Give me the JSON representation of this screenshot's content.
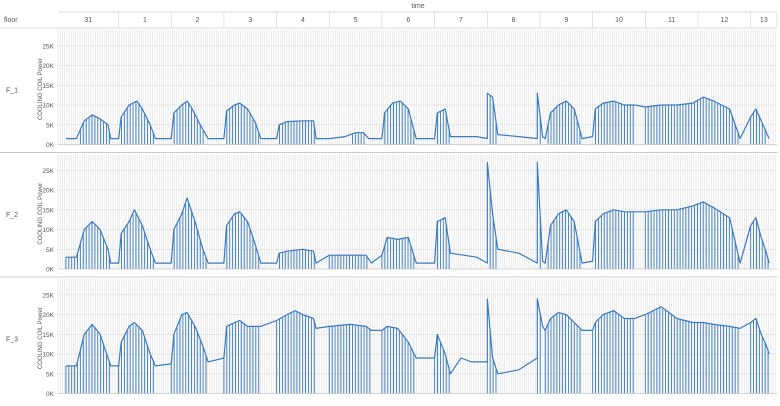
{
  "chart_data": {
    "type": "line",
    "top_axis_title": "time",
    "row_header_label": "floor",
    "ylabel": "COOLING COIL Power",
    "ylim": [
      0,
      28000
    ],
    "y_ticks": [
      0,
      5000,
      10000,
      15000,
      20000,
      25000
    ],
    "y_tick_labels": [
      "0K",
      "5K",
      "10K",
      "15K",
      "20K",
      "25K"
    ],
    "x_range_days": [
      31,
      13
    ],
    "x_tick_labels": [
      "31",
      "1",
      "2",
      "3",
      "4",
      "5",
      "6",
      "7",
      "8",
      "9",
      "10",
      "11",
      "12",
      "13"
    ],
    "series_color": "#3a7bbf",
    "grid": true,
    "series": [
      {
        "name": "F_1",
        "points": [
          [
            0.0,
            1500
          ],
          [
            0.2,
            1500
          ],
          [
            0.35,
            6000
          ],
          [
            0.5,
            7500
          ],
          [
            0.65,
            6500
          ],
          [
            0.8,
            5000
          ],
          [
            0.85,
            1500
          ],
          [
            1.0,
            1500
          ],
          [
            1.05,
            7000
          ],
          [
            1.2,
            10000
          ],
          [
            1.35,
            11000
          ],
          [
            1.45,
            9000
          ],
          [
            1.6,
            5000
          ],
          [
            1.7,
            1500
          ],
          [
            2.0,
            1500
          ],
          [
            2.05,
            8000
          ],
          [
            2.2,
            10000
          ],
          [
            2.3,
            11000
          ],
          [
            2.4,
            9000
          ],
          [
            2.55,
            5000
          ],
          [
            2.7,
            1500
          ],
          [
            3.0,
            1500
          ],
          [
            3.05,
            8500
          ],
          [
            3.2,
            10000
          ],
          [
            3.3,
            10500
          ],
          [
            3.45,
            9000
          ],
          [
            3.6,
            5500
          ],
          [
            3.7,
            1500
          ],
          [
            4.0,
            1500
          ],
          [
            4.05,
            5000
          ],
          [
            4.2,
            5800
          ],
          [
            4.5,
            6000
          ],
          [
            4.7,
            6000
          ],
          [
            4.75,
            1500
          ],
          [
            5.0,
            1500
          ],
          [
            5.3,
            2000
          ],
          [
            5.5,
            3000
          ],
          [
            5.65,
            3000
          ],
          [
            5.75,
            1500
          ],
          [
            6.0,
            1500
          ],
          [
            6.05,
            8000
          ],
          [
            6.2,
            10500
          ],
          [
            6.35,
            11000
          ],
          [
            6.5,
            9000
          ],
          [
            6.65,
            1500
          ],
          [
            7.0,
            1500
          ],
          [
            7.05,
            8000
          ],
          [
            7.2,
            9000
          ],
          [
            7.3,
            2000
          ],
          [
            7.8,
            2000
          ],
          [
            8.0,
            1500
          ],
          [
            8.0,
            13000
          ],
          [
            8.1,
            12000
          ],
          [
            8.2,
            2500
          ],
          [
            8.6,
            2000
          ],
          [
            8.95,
            1500
          ],
          [
            8.95,
            13000
          ],
          [
            9.05,
            2000
          ],
          [
            9.1,
            1500
          ],
          [
            9.2,
            8000
          ],
          [
            9.35,
            10000
          ],
          [
            9.5,
            11000
          ],
          [
            9.65,
            9000
          ],
          [
            9.8,
            1500
          ],
          [
            10.0,
            2000
          ],
          [
            10.05,
            9000
          ],
          [
            10.2,
            10500
          ],
          [
            10.4,
            11000
          ],
          [
            10.6,
            10000
          ],
          [
            10.8,
            10000
          ],
          [
            11.0,
            9500
          ],
          [
            11.3,
            10000
          ],
          [
            11.6,
            10000
          ],
          [
            11.9,
            10500
          ],
          [
            12.1,
            12000
          ],
          [
            12.3,
            11000
          ],
          [
            12.6,
            9000
          ],
          [
            12.8,
            1500
          ],
          [
            13.0,
            7000
          ],
          [
            13.1,
            9000
          ],
          [
            13.2,
            6000
          ],
          [
            13.3,
            3000
          ],
          [
            13.35,
            1500
          ]
        ]
      },
      {
        "name": "F_2",
        "points": [
          [
            0.0,
            3000
          ],
          [
            0.2,
            3000
          ],
          [
            0.35,
            10000
          ],
          [
            0.5,
            12000
          ],
          [
            0.65,
            10000
          ],
          [
            0.8,
            5000
          ],
          [
            0.85,
            1500
          ],
          [
            1.0,
            1500
          ],
          [
            1.05,
            9000
          ],
          [
            1.2,
            12000
          ],
          [
            1.3,
            15000
          ],
          [
            1.45,
            11000
          ],
          [
            1.6,
            5000
          ],
          [
            1.7,
            1500
          ],
          [
            2.0,
            1500
          ],
          [
            2.05,
            10000
          ],
          [
            2.2,
            14000
          ],
          [
            2.3,
            18000
          ],
          [
            2.45,
            12000
          ],
          [
            2.6,
            5000
          ],
          [
            2.7,
            1500
          ],
          [
            3.0,
            1500
          ],
          [
            3.05,
            11000
          ],
          [
            3.2,
            14000
          ],
          [
            3.3,
            14500
          ],
          [
            3.45,
            12000
          ],
          [
            3.6,
            6000
          ],
          [
            3.7,
            1500
          ],
          [
            4.0,
            1500
          ],
          [
            4.05,
            4000
          ],
          [
            4.2,
            4500
          ],
          [
            4.5,
            5000
          ],
          [
            4.7,
            4500
          ],
          [
            4.75,
            1500
          ],
          [
            5.0,
            3500
          ],
          [
            5.4,
            3500
          ],
          [
            5.7,
            3500
          ],
          [
            5.8,
            1500
          ],
          [
            6.0,
            3500
          ],
          [
            6.1,
            8000
          ],
          [
            6.3,
            7500
          ],
          [
            6.5,
            8000
          ],
          [
            6.65,
            1500
          ],
          [
            7.0,
            1500
          ],
          [
            7.05,
            12000
          ],
          [
            7.2,
            13000
          ],
          [
            7.3,
            4000
          ],
          [
            7.8,
            3000
          ],
          [
            8.0,
            1500
          ],
          [
            8.0,
            27000
          ],
          [
            8.1,
            14000
          ],
          [
            8.2,
            5000
          ],
          [
            8.6,
            4000
          ],
          [
            8.95,
            1500
          ],
          [
            8.95,
            27000
          ],
          [
            9.05,
            2000
          ],
          [
            9.1,
            1500
          ],
          [
            9.2,
            11000
          ],
          [
            9.35,
            14000
          ],
          [
            9.5,
            15000
          ],
          [
            9.65,
            12000
          ],
          [
            9.8,
            1500
          ],
          [
            10.0,
            2000
          ],
          [
            10.05,
            12000
          ],
          [
            10.2,
            14000
          ],
          [
            10.4,
            15000
          ],
          [
            10.6,
            14500
          ],
          [
            10.8,
            14500
          ],
          [
            11.0,
            14500
          ],
          [
            11.3,
            15000
          ],
          [
            11.6,
            15000
          ],
          [
            11.9,
            16000
          ],
          [
            12.1,
            17000
          ],
          [
            12.3,
            15500
          ],
          [
            12.6,
            13000
          ],
          [
            12.8,
            1500
          ],
          [
            13.0,
            11000
          ],
          [
            13.1,
            13000
          ],
          [
            13.2,
            8000
          ],
          [
            13.3,
            4000
          ],
          [
            13.35,
            1500
          ]
        ]
      },
      {
        "name": "F_3",
        "points": [
          [
            0.0,
            7000
          ],
          [
            0.2,
            7000
          ],
          [
            0.35,
            15000
          ],
          [
            0.5,
            17500
          ],
          [
            0.65,
            15000
          ],
          [
            0.8,
            9000
          ],
          [
            0.85,
            7000
          ],
          [
            1.0,
            7000
          ],
          [
            1.05,
            13000
          ],
          [
            1.2,
            17000
          ],
          [
            1.3,
            18000
          ],
          [
            1.45,
            16000
          ],
          [
            1.6,
            10000
          ],
          [
            1.7,
            7000
          ],
          [
            2.0,
            7500
          ],
          [
            2.05,
            15000
          ],
          [
            2.2,
            20000
          ],
          [
            2.3,
            20500
          ],
          [
            2.45,
            17000
          ],
          [
            2.6,
            12000
          ],
          [
            2.7,
            8000
          ],
          [
            3.0,
            9000
          ],
          [
            3.05,
            17000
          ],
          [
            3.2,
            18000
          ],
          [
            3.3,
            18500
          ],
          [
            3.45,
            17000
          ],
          [
            3.6,
            17000
          ],
          [
            3.7,
            17000
          ],
          [
            4.0,
            18500
          ],
          [
            4.2,
            20000
          ],
          [
            4.35,
            21000
          ],
          [
            4.5,
            20000
          ],
          [
            4.7,
            19000
          ],
          [
            4.75,
            16500
          ],
          [
            5.0,
            17000
          ],
          [
            5.4,
            17500
          ],
          [
            5.7,
            17000
          ],
          [
            5.8,
            16000
          ],
          [
            6.0,
            16000
          ],
          [
            6.1,
            17000
          ],
          [
            6.3,
            16500
          ],
          [
            6.5,
            13000
          ],
          [
            6.65,
            9000
          ],
          [
            7.0,
            9000
          ],
          [
            7.05,
            15000
          ],
          [
            7.2,
            10000
          ],
          [
            7.3,
            5000
          ],
          [
            7.5,
            9000
          ],
          [
            7.7,
            8000
          ],
          [
            8.0,
            8000
          ],
          [
            8.0,
            24000
          ],
          [
            8.1,
            9000
          ],
          [
            8.2,
            5000
          ],
          [
            8.6,
            6000
          ],
          [
            8.95,
            9000
          ],
          [
            8.95,
            24000
          ],
          [
            9.05,
            17000
          ],
          [
            9.1,
            16000
          ],
          [
            9.2,
            19000
          ],
          [
            9.35,
            20500
          ],
          [
            9.5,
            20000
          ],
          [
            9.65,
            18000
          ],
          [
            9.8,
            16000
          ],
          [
            10.0,
            16000
          ],
          [
            10.05,
            18000
          ],
          [
            10.2,
            20000
          ],
          [
            10.4,
            21000
          ],
          [
            10.6,
            19000
          ],
          [
            10.8,
            19000
          ],
          [
            11.0,
            20000
          ],
          [
            11.3,
            22000
          ],
          [
            11.6,
            19000
          ],
          [
            11.9,
            18000
          ],
          [
            12.1,
            18000
          ],
          [
            12.3,
            17500
          ],
          [
            12.6,
            17000
          ],
          [
            12.8,
            16500
          ],
          [
            13.0,
            18000
          ],
          [
            13.1,
            19000
          ],
          [
            13.2,
            15000
          ],
          [
            13.3,
            12000
          ],
          [
            13.35,
            10000
          ]
        ]
      }
    ],
    "hatched_days": [
      [
        0.0,
        0.85
      ],
      [
        1.0,
        1.7
      ],
      [
        2.0,
        2.7
      ],
      [
        3.0,
        3.7
      ],
      [
        4.0,
        4.75
      ],
      [
        5.0,
        5.8
      ],
      [
        6.0,
        6.65
      ],
      [
        7.0,
        7.3
      ],
      [
        8.0,
        8.2
      ],
      [
        8.95,
        9.05
      ],
      [
        9.1,
        9.8
      ],
      [
        10.0,
        10.8
      ],
      [
        11.0,
        12.8
      ],
      [
        13.0,
        13.35
      ]
    ]
  }
}
